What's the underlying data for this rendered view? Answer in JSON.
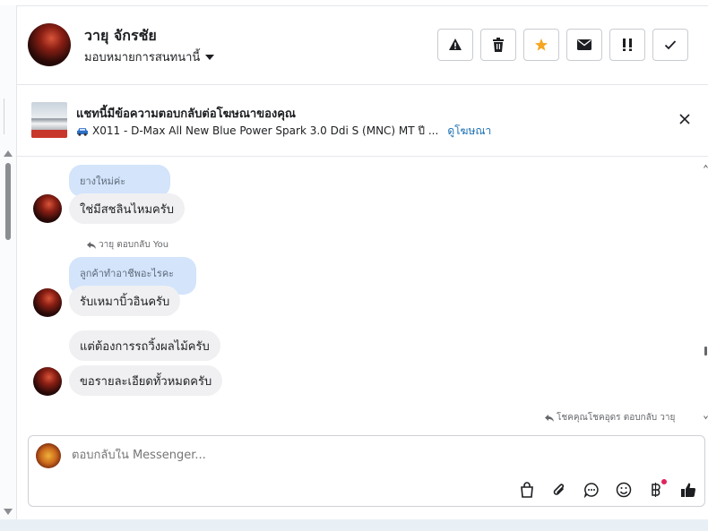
{
  "header": {
    "contact_name": "วายุ จักรชัย",
    "assign_label": "มอบหมายการสนทนานี้"
  },
  "actions": [
    {
      "icon": "warning-icon"
    },
    {
      "icon": "trash-icon"
    },
    {
      "icon": "star-icon",
      "color": "#f5a623"
    },
    {
      "icon": "mail-icon"
    },
    {
      "icon": "follow-up-icon"
    },
    {
      "icon": "check-icon"
    }
  ],
  "ad": {
    "title": "แชทนี้มีข้อความตอบกลับต่อโฆษณาของคุณ",
    "product": "X011 - D-Max All New Blue Power Spark 3.0 Ddi S (MNC) MT ปี ...",
    "link_label": "ดูโฆษณา"
  },
  "messages": {
    "quote1": "ยางใหม่ค่ะ",
    "bubble1": "ใช่มีสชลินไหมครับ",
    "reply_note1": "วายุ ตอบกลับ You",
    "quote2": "ลูกค้าทำอาชีพอะไรคะ",
    "bubble2": "รับเหมาบิ้วอินครับ",
    "bubble3": "แต่ต้องการรถวิ้งผลไม้ครับ",
    "bubble4": "ขอรายละเอียดทั้วหมดครับ",
    "reply_note2": "โชคคุณโชคอุดร ตอบกลับ วายุ"
  },
  "composer": {
    "placeholder": "ตอบกลับใน Messenger..."
  },
  "colors": {
    "accent_link": "#1a6fb3",
    "quote_bg": "#d3e4fb",
    "bubble_bg": "#f0f0f2"
  }
}
